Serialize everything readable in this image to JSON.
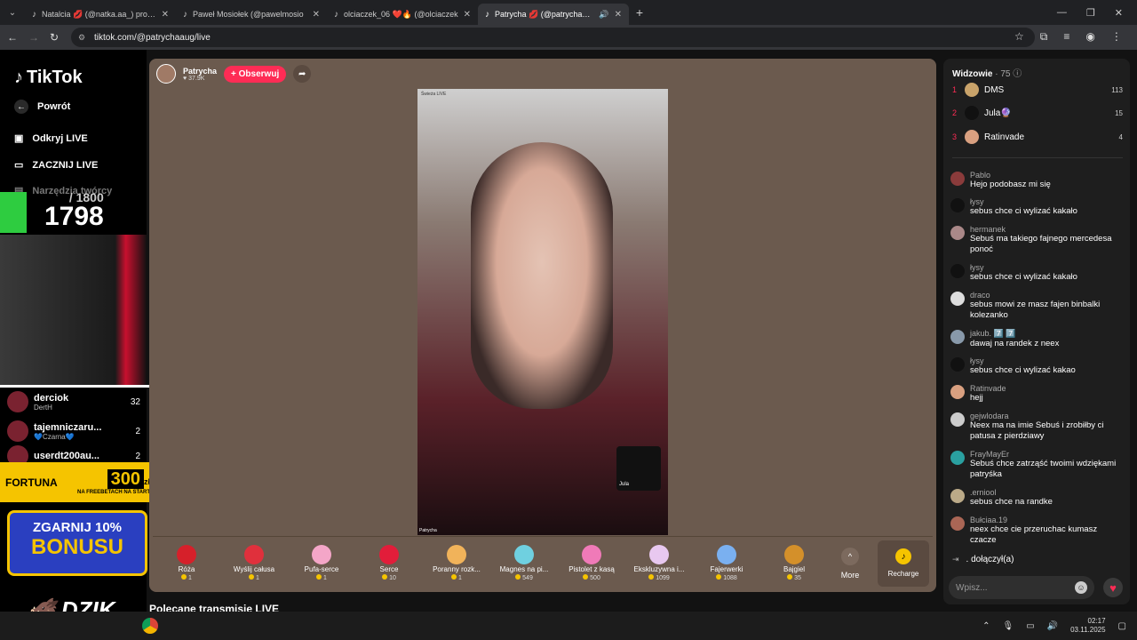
{
  "tabs": [
    {
      "label": "Natalcia 💋 (@natka.aa_) prowa",
      "active": false
    },
    {
      "label": "Paweł Mosiołek (@pawelmosio",
      "active": false
    },
    {
      "label": "olciaczek_06 ❤️🔥 (@olciaczek",
      "active": false
    },
    {
      "label": "Patrycha 💋 (@patrychaaug",
      "active": true
    }
  ],
  "address": {
    "url": "tiktok.com/@patrychaaug/live"
  },
  "sidebar": {
    "logo": "TikTok",
    "back": "Powrót",
    "discover": "Odkryj LIVE",
    "start": "ZACZNIJ LIVE",
    "tools": "Narzędzia twórcy"
  },
  "overlay": {
    "goal": "/ 1800",
    "count": "1798",
    "fortuna_brand": "FORTUNA",
    "fortuna_amount": "300",
    "fortuna_currency": "zł",
    "fortuna_sub": "NA FREEBETACH NA START",
    "bonus_line1": "ZGARNIJ 10%",
    "bonus_line2": "BONUSU",
    "dzik": "DZIK"
  },
  "left_viewers": [
    {
      "name": "derciok",
      "sub": "DertH",
      "count": "32"
    },
    {
      "name": "tajemniczaru...",
      "sub": "💙Czarna💙",
      "count": "2"
    },
    {
      "name": "userdt200au...",
      "sub": "",
      "count": "2"
    }
  ],
  "host": {
    "name": "Patrycha",
    "likes": "37.9K",
    "follow_label": "+ Obserwuj"
  },
  "video": {
    "label_top": "Świeża LIVE",
    "label_bottom": "Patrycha",
    "pip_name": "Jula"
  },
  "gifts": [
    {
      "name": "Róża",
      "price": "1"
    },
    {
      "name": "Wyślij całusa",
      "price": "1"
    },
    {
      "name": "Pufa-serce",
      "price": "1"
    },
    {
      "name": "Serce",
      "price": "10"
    },
    {
      "name": "Poranny rozk...",
      "price": "1"
    },
    {
      "name": "Magnes na pi...",
      "price": "549"
    },
    {
      "name": "Pistolet z kasą",
      "price": "500"
    },
    {
      "name": "Ekskluzywna i...",
      "price": "1099"
    },
    {
      "name": "Fajerwerki",
      "price": "1088"
    },
    {
      "name": "Bajgiel",
      "price": "35"
    }
  ],
  "gift_more": "More",
  "recharge": "Recharge",
  "recommended": "Polecane transmisje LIVE",
  "right_panel": {
    "title": "Widzowie",
    "count": "· 75",
    "top": [
      {
        "rank": "1",
        "name": "DMS",
        "score": "113"
      },
      {
        "rank": "2",
        "name": "Jula🔮",
        "score": "15"
      },
      {
        "rank": "3",
        "name": "Ratinvade",
        "score": "4"
      }
    ],
    "messages": [
      {
        "user": "Pablo",
        "text": "Hejo podobasz mi się"
      },
      {
        "user": "łysy",
        "text": "sebus chce ci wylizać kakało"
      },
      {
        "user": "hermanek",
        "text": "Sebuś ma takiego fajnego mercedesa ponoć"
      },
      {
        "user": "łysy",
        "text": "sebus chce ci wylizać kakało"
      },
      {
        "user": "draco",
        "text": "sebus mowi ze masz fajen binbalki kolezanko"
      },
      {
        "user": "jakub. 7️⃣ 7️⃣",
        "text": "dawaj na randek z neex"
      },
      {
        "user": "łysy",
        "text": "sebus chce ci wylizać kakao"
      },
      {
        "user": "Ratinvade",
        "text": "hejj"
      },
      {
        "user": "gejwlodara",
        "text": "Neex ma na imie Sebuś i zrobiłby ci patusa z pierdziawy"
      },
      {
        "user": "FrayMayEr",
        "text": "Sebuś chce zatrząść twoimi wdziękami patryśka"
      },
      {
        "user": ".erniool",
        "text": "sebus chce na randke"
      },
      {
        "user": "Bułciaa.19",
        "text": "neex chce cie przeruchac kumasz czacze"
      }
    ],
    "joined": ". dołączył(a)",
    "input_placeholder": "Wpisz..."
  },
  "taskbar": {
    "time": "02:17",
    "date": "03.11.2025"
  },
  "colors": {
    "accent": "#fe2c55",
    "stage": "#6b5a4e",
    "panel": "#1e1e1e"
  }
}
